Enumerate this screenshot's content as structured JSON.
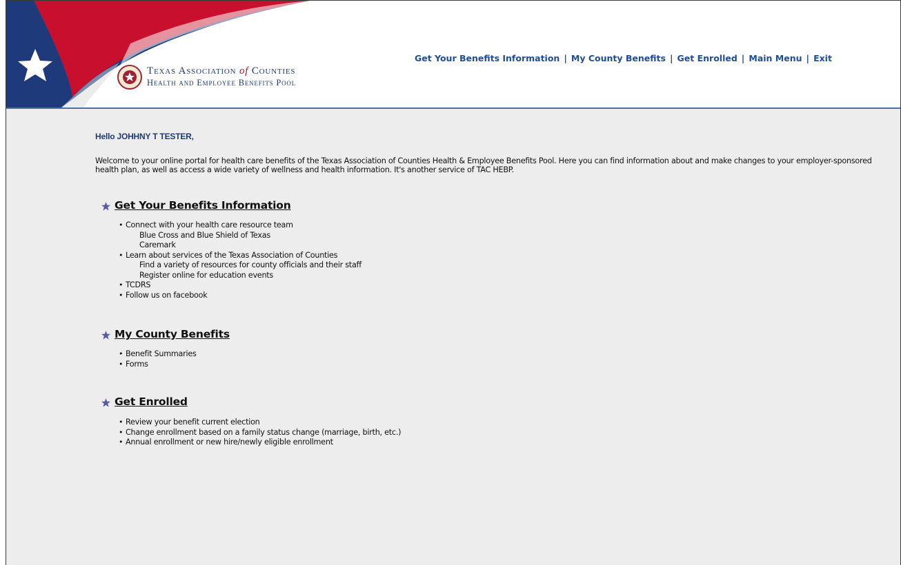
{
  "header": {
    "logo_line1": "Texas Association",
    "logo_of": "of",
    "logo_line1b": "Counties",
    "logo_line2": "Health and Employee Benefits Pool",
    "nav": [
      {
        "label": "Get Your Benefits Information"
      },
      {
        "label": "My County Benefits"
      },
      {
        "label": "Get Enrolled"
      },
      {
        "label": "Main Menu"
      },
      {
        "label": "Exit"
      }
    ],
    "separator": "|"
  },
  "main": {
    "greeting": "Hello JOHHNY T TESTER,",
    "welcome": "Welcome to your online portal for health care benefits of the Texas Association of Counties Health & Employee Benefits Pool. Here you can find information about and make changes to your employer-sponsored health plan, as well as access a wide variety of wellness and health information. It's another service of TAC HEBP.",
    "sections": [
      {
        "title": "Get Your Benefits Information",
        "items": [
          {
            "label": "Connect with your health care resource team"
          },
          {
            "label": "Blue Cross and Blue Shield of Texas"
          },
          {
            "label": "Caremark"
          },
          {
            "label": "Learn about services of the Texas Association of Counties"
          },
          {
            "label": "Find a variety of resources for county officials and their staff"
          },
          {
            "label": "Register online for education events"
          },
          {
            "label": "TCDRS"
          },
          {
            "label": "Follow us on facebook"
          }
        ]
      },
      {
        "title": "My County Benefits",
        "items": [
          {
            "label": "Benefit Summaries"
          },
          {
            "label": "Forms"
          }
        ]
      },
      {
        "title": "Get Enrolled",
        "items": [
          {
            "label": "Review your benefit current election"
          },
          {
            "label": "Change enrollment based on a family status change (marriage, birth, etc.)"
          },
          {
            "label": "Annual enrollment or new hire/newly eligible enrollment"
          }
        ]
      }
    ]
  },
  "colors": {
    "link_blue": "#1f4e96",
    "flag_red": "#c8102e",
    "flag_blue": "#1f3a7a",
    "page_bg": "#ededed"
  }
}
